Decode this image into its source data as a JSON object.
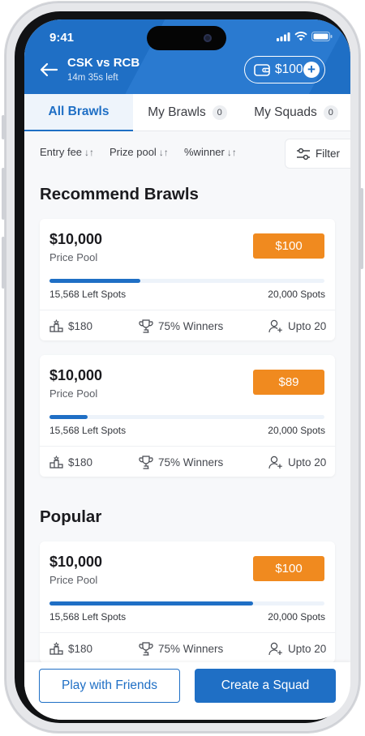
{
  "status_bar": {
    "time": "9:41"
  },
  "header": {
    "title": "CSK vs RCB",
    "time_left": "14m 35s left",
    "wallet_amount": "$100",
    "wallet_plus": "+"
  },
  "tabs": [
    {
      "label": "All Brawls",
      "count": null,
      "active": true
    },
    {
      "label": "My Brawls",
      "count": "0",
      "active": false
    },
    {
      "label": "My Squads",
      "count": "0",
      "active": false
    }
  ],
  "sort": {
    "entry_fee": "Entry fee",
    "prize_pool": "Prize pool",
    "winner_pct": "%winner",
    "arrows": "↓↑",
    "filter": "Filter"
  },
  "sections": {
    "recommended": "Recommend Brawls",
    "popular": "Popular"
  },
  "cards": [
    {
      "pool_amount": "$10,000",
      "pool_label": "Price Pool",
      "entry_fee": "$100",
      "progress": 0.33,
      "left_spots": "15,568 Left Spots",
      "total_spots": "20,000 Spots",
      "first_prize": "$180",
      "winners": "75% Winners",
      "upto": "Upto 20"
    },
    {
      "pool_amount": "$10,000",
      "pool_label": "Price Pool",
      "entry_fee": "$89",
      "progress": 0.14,
      "left_spots": "15,568 Left Spots",
      "total_spots": "20,000 Spots",
      "first_prize": "$180",
      "winners": "75% Winners",
      "upto": "Upto 20"
    },
    {
      "pool_amount": "$10,000",
      "pool_label": "Price Pool",
      "entry_fee": "$100",
      "progress": 0.74,
      "left_spots": "15,568 Left Spots",
      "total_spots": "20,000 Spots",
      "first_prize": "$180",
      "winners": "75% Winners",
      "upto": "Upto 20"
    }
  ],
  "bottom": {
    "play_friends": "Play with Friends",
    "create_squad": "Create a Squad"
  },
  "colors": {
    "primary": "#1f6fc5",
    "accent": "#f08a1f",
    "background": "#f7f8fa"
  }
}
